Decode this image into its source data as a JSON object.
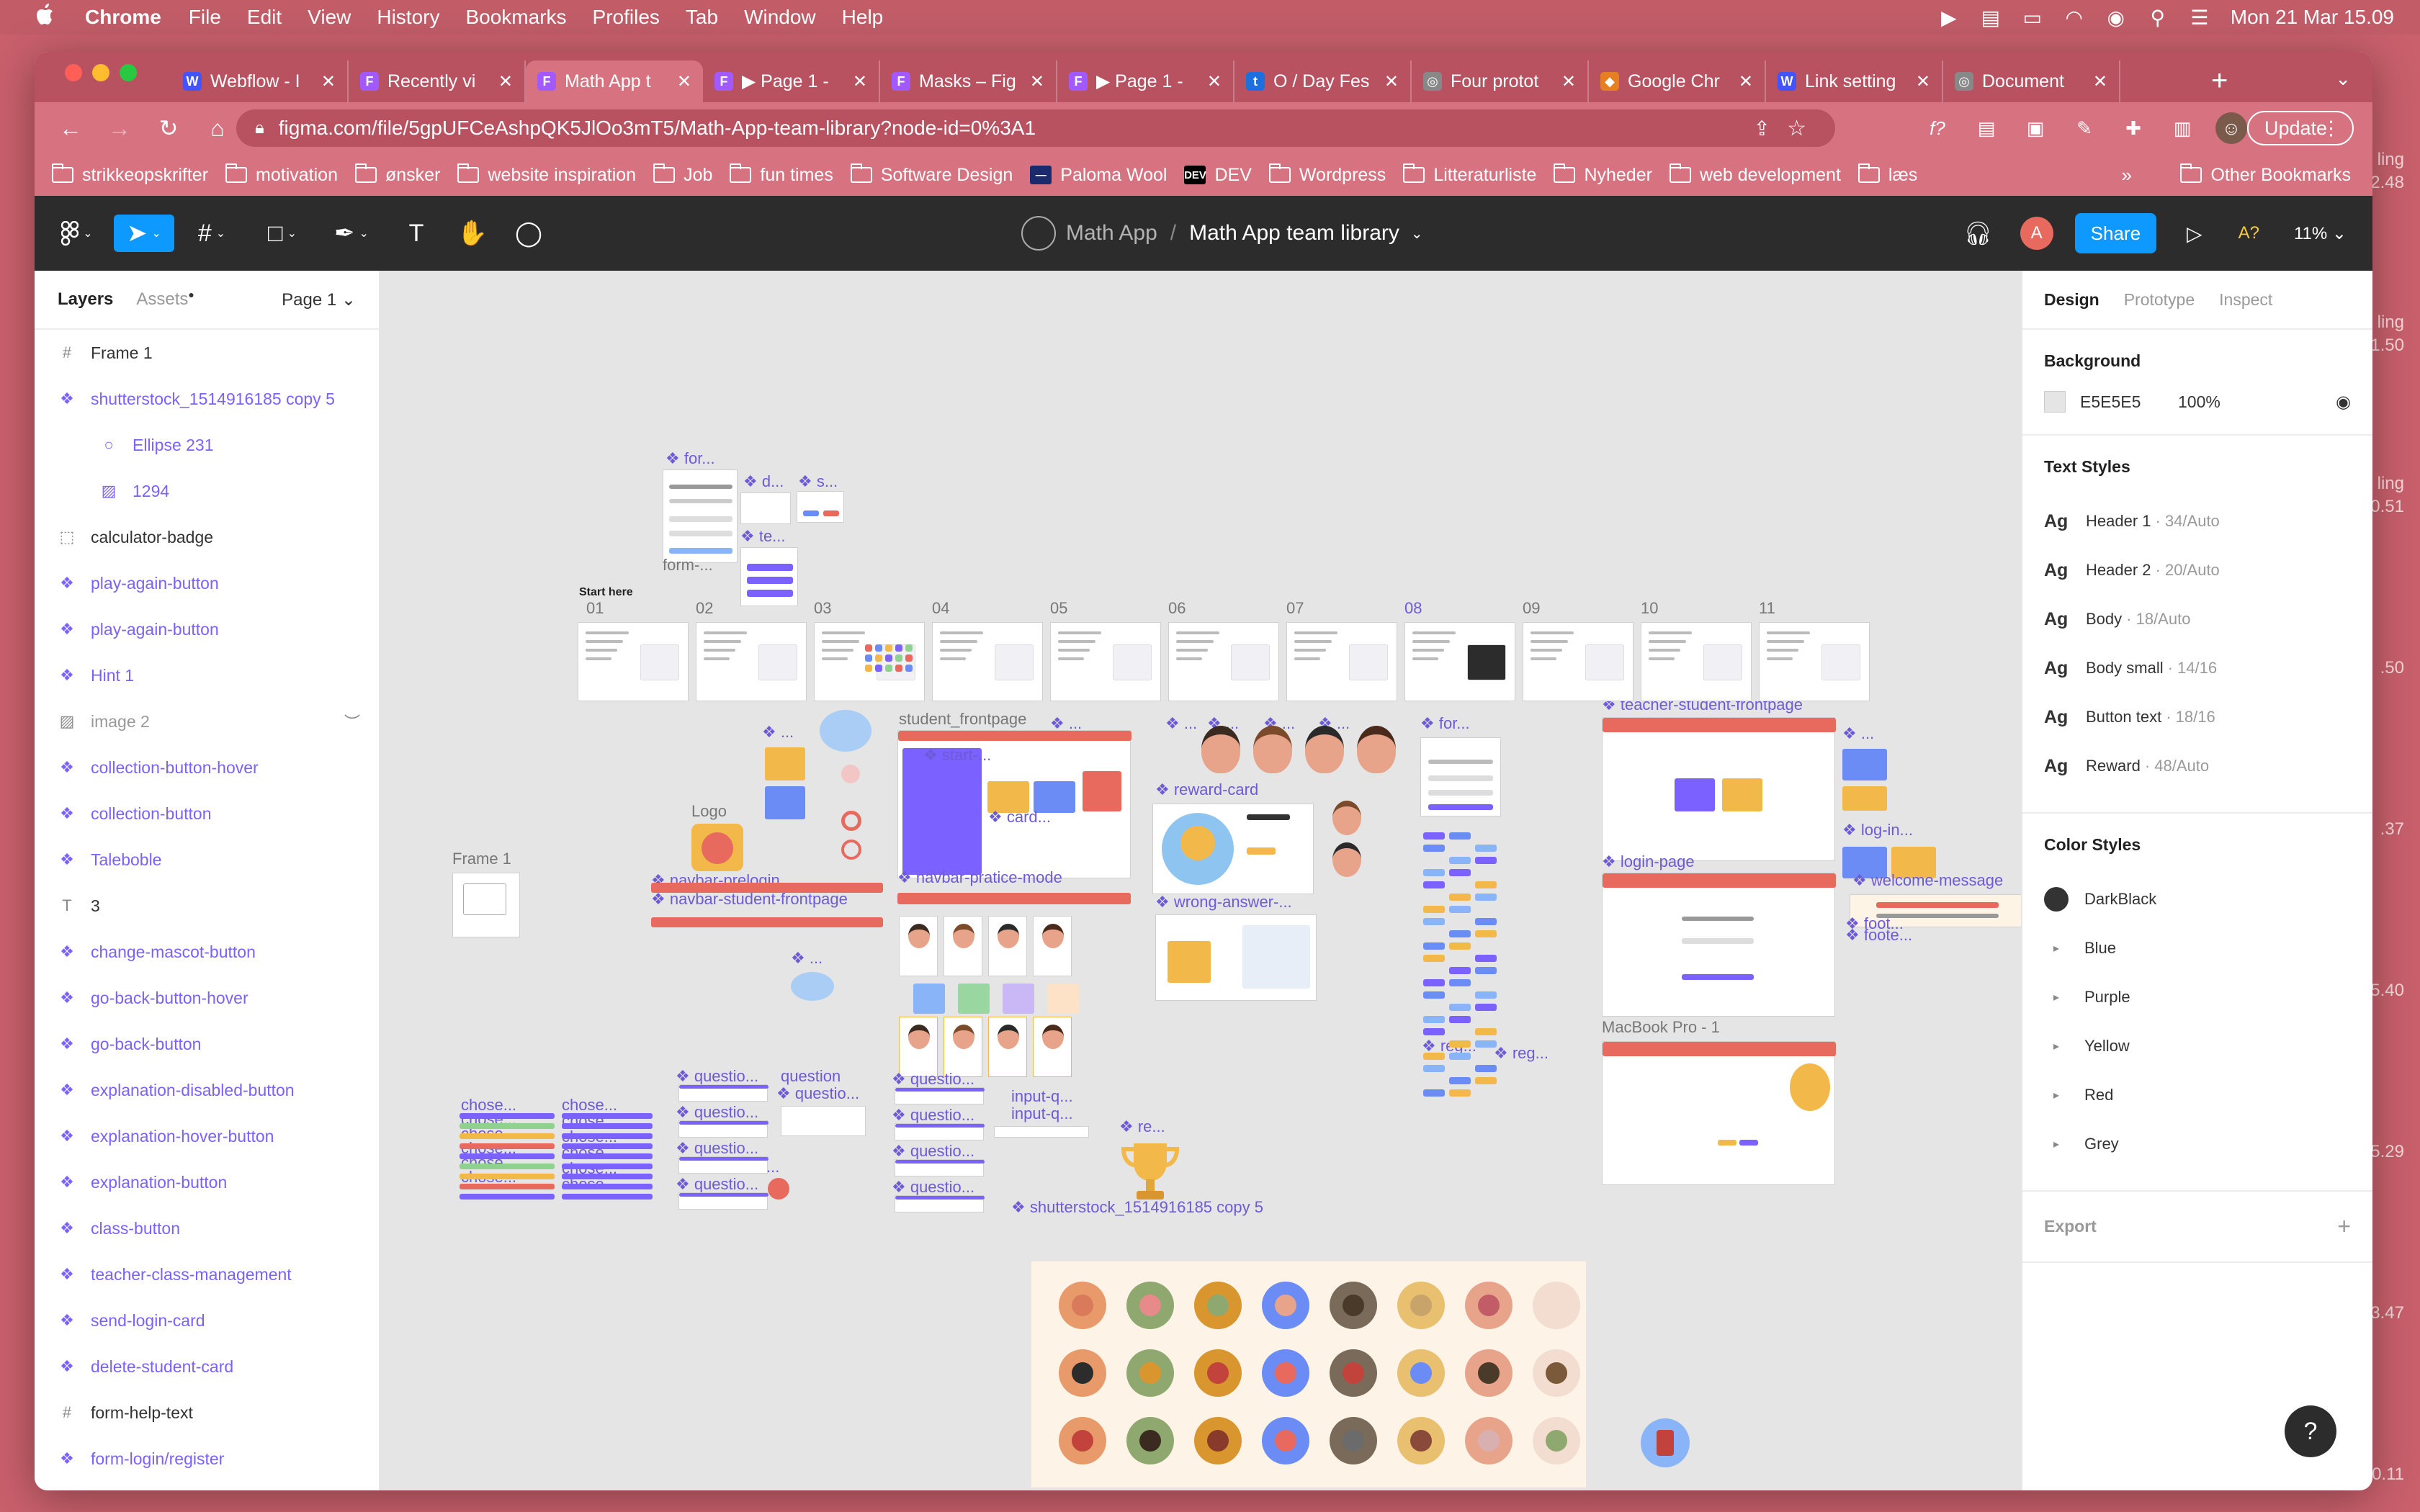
{
  "menubar": {
    "app_name": "Chrome",
    "menus": [
      "File",
      "Edit",
      "View",
      "History",
      "Bookmarks",
      "Profiles",
      "Tab",
      "Window",
      "Help"
    ],
    "datetime": "Mon 21 Mar  15.09"
  },
  "browser": {
    "tabs": [
      {
        "title": "Webflow - I",
        "icon": "webflow-icon",
        "color": "#4353ff",
        "glyph": "W"
      },
      {
        "title": "Recently vi",
        "icon": "figma-icon",
        "color": "#a259ff",
        "glyph": "F"
      },
      {
        "title": "Math App t",
        "icon": "figma-icon",
        "color": "#a259ff",
        "glyph": "F"
      },
      {
        "title": "▶ Page 1 -",
        "icon": "figma-icon",
        "color": "#a259ff",
        "glyph": "F"
      },
      {
        "title": "Masks – Fig",
        "icon": "figma-icon",
        "color": "#a259ff",
        "glyph": "F"
      },
      {
        "title": "▶ Page 1 -",
        "icon": "figma-icon",
        "color": "#a259ff",
        "glyph": "F"
      },
      {
        "title": "O / Day Fes",
        "icon": "t-icon",
        "color": "#1d6fe0",
        "glyph": "t"
      },
      {
        "title": "Four protot",
        "icon": "globe-icon",
        "color": "#888888",
        "glyph": "◎"
      },
      {
        "title": "Google Chr",
        "icon": "chrome-support-icon",
        "color": "#e67e22",
        "glyph": "◆"
      },
      {
        "title": "Link setting",
        "icon": "webflow-icon",
        "color": "#4353ff",
        "glyph": "W"
      },
      {
        "title": "Document",
        "icon": "globe-icon",
        "color": "#888888",
        "glyph": "◎"
      }
    ],
    "active_tab_index": 2,
    "url": "figma.com/file/5gpUFCeAshpQK5JlOo3mT5/Math-App-team-library?node-id=0%3A1",
    "update_label": "Update",
    "bookmarks": [
      {
        "label": "strikkeopskrifter",
        "type": "folder"
      },
      {
        "label": "motivation",
        "type": "folder"
      },
      {
        "label": "ønsker",
        "type": "folder"
      },
      {
        "label": "website inspiration",
        "type": "folder"
      },
      {
        "label": "Job",
        "type": "folder"
      },
      {
        "label": "fun times",
        "type": "folder"
      },
      {
        "label": "Software Design",
        "type": "folder"
      },
      {
        "label": "Paloma Wool",
        "type": "site",
        "glyph": "—",
        "color": "#1a2a6c"
      },
      {
        "label": "DEV",
        "type": "site",
        "glyph": "DEV",
        "color": "#000000"
      },
      {
        "label": "Wordpress",
        "type": "folder"
      },
      {
        "label": "Litteraturliste",
        "type": "folder"
      },
      {
        "label": "Nyheder",
        "type": "folder"
      },
      {
        "label": "web development",
        "type": "folder"
      },
      {
        "label": "læs",
        "type": "folder"
      }
    ],
    "other_bookmarks": "Other Bookmarks",
    "more": "»"
  },
  "figma": {
    "project": "Math App",
    "separator": "/",
    "file": "Math App team library",
    "avatar_letter": "A",
    "share_label": "Share",
    "a11y_label": "A?",
    "zoom": "11%",
    "layers_tab": "Layers",
    "assets_tab": "Assets",
    "page_label": "Page 1",
    "layers": [
      {
        "name": "Frame 1",
        "icon": "#",
        "kind": "frame"
      },
      {
        "name": "shutterstock_1514916185 copy 5",
        "icon": "❖",
        "kind": "comp"
      },
      {
        "name": "Ellipse 231",
        "icon": "○",
        "kind": "comp-indent"
      },
      {
        "name": "1294",
        "icon": "▨",
        "kind": "comp-indent"
      },
      {
        "name": "calculator-badge",
        "icon": "⬚",
        "kind": "frame"
      },
      {
        "name": "play-again-button",
        "icon": "❖",
        "kind": "comp"
      },
      {
        "name": "play-again-button",
        "icon": "❖",
        "kind": "comp"
      },
      {
        "name": "Hint 1",
        "icon": "❖",
        "kind": "comp"
      },
      {
        "name": "image 2",
        "icon": "▨",
        "kind": "muted"
      },
      {
        "name": "collection-button-hover",
        "icon": "❖",
        "kind": "comp"
      },
      {
        "name": "collection-button",
        "icon": "❖",
        "kind": "comp"
      },
      {
        "name": "Taleboble",
        "icon": "❖",
        "kind": "comp"
      },
      {
        "name": "3",
        "icon": "T",
        "kind": "frame"
      },
      {
        "name": "change-mascot-button",
        "icon": "❖",
        "kind": "comp"
      },
      {
        "name": "go-back-button-hover",
        "icon": "❖",
        "kind": "comp"
      },
      {
        "name": "go-back-button",
        "icon": "❖",
        "kind": "comp"
      },
      {
        "name": "explanation-disabled-button",
        "icon": "❖",
        "kind": "comp"
      },
      {
        "name": "explanation-hover-button",
        "icon": "❖",
        "kind": "comp"
      },
      {
        "name": "explanation-button",
        "icon": "❖",
        "kind": "comp"
      },
      {
        "name": "class-button",
        "icon": "❖",
        "kind": "comp"
      },
      {
        "name": "teacher-class-management",
        "icon": "❖",
        "kind": "comp"
      },
      {
        "name": "send-login-card",
        "icon": "❖",
        "kind": "comp"
      },
      {
        "name": "delete-student-card",
        "icon": "❖",
        "kind": "comp"
      },
      {
        "name": "form-help-text",
        "icon": "#",
        "kind": "frame"
      },
      {
        "name": "form-login/register",
        "icon": "❖",
        "kind": "comp"
      }
    ],
    "design": {
      "tabs": [
        "Design",
        "Prototype",
        "Inspect"
      ],
      "background_label": "Background",
      "bg_hex": "E5E5E5",
      "bg_opacity": "100%",
      "text_styles_label": "Text Styles",
      "text_styles": [
        {
          "name": "Header 1",
          "meta": "· 34/Auto",
          "ag": "Ag"
        },
        {
          "name": "Header 2",
          "meta": "· 20/Auto",
          "ag": "Ag"
        },
        {
          "name": "Body",
          "meta": "· 18/Auto",
          "ag": "Ag"
        },
        {
          "name": "Body small",
          "meta": "· 14/16",
          "ag": "Ag"
        },
        {
          "name": "Button text",
          "meta": "· 18/16",
          "ag": "Ag"
        },
        {
          "name": "Reward",
          "meta": "· 48/Auto",
          "ag": "Ag"
        }
      ],
      "color_styles_label": "Color Styles",
      "color_styles": [
        {
          "name": "DarkBlack",
          "swatch": "#333333"
        },
        {
          "name": "Blue",
          "swatch": null
        },
        {
          "name": "Purple",
          "swatch": null
        },
        {
          "name": "Yellow",
          "swatch": null
        },
        {
          "name": "Red",
          "swatch": null
        },
        {
          "name": "Grey",
          "swatch": null
        }
      ],
      "export_label": "Export"
    },
    "canvas": {
      "start_here": "Start here",
      "step_numbers": [
        "01",
        "02",
        "03",
        "04",
        "05",
        "06",
        "07",
        "08",
        "09",
        "10",
        "11"
      ],
      "labels": {
        "frame1": "Frame 1",
        "logo": "Logo",
        "student_frontpage": "student_frontpage",
        "navbar_prelogin": "navbar-prelogin",
        "navbar_student_frontpage": "navbar-student-frontpage",
        "navbar_pratice_mode": "navbar-pratice-mode",
        "reward_card": "reward-card",
        "wrong_answer": "wrong-answer-...",
        "teacher_student_frontpage": "teacher-student-frontpage",
        "login_page": "login-page",
        "welcome_message": "welcome-message",
        "macbook": "MacBook Pro - 1",
        "shutterstock": "shutterstock_1514916185 copy 5",
        "form": "for...",
        "start": "start-...",
        "card": "card...",
        "question": "question",
        "input_q": "input-q...",
        "reg": "reg...",
        "log_in": "log-in...",
        "foot": "foot...",
        "chose": "chose..."
      }
    }
  },
  "right_peek": [
    "ling",
    "2.48",
    "ling",
    "1.50",
    "ling",
    "0.51",
    ".50",
    ".37",
    "5.40",
    "5.29",
    "3.47",
    "0.11"
  ]
}
